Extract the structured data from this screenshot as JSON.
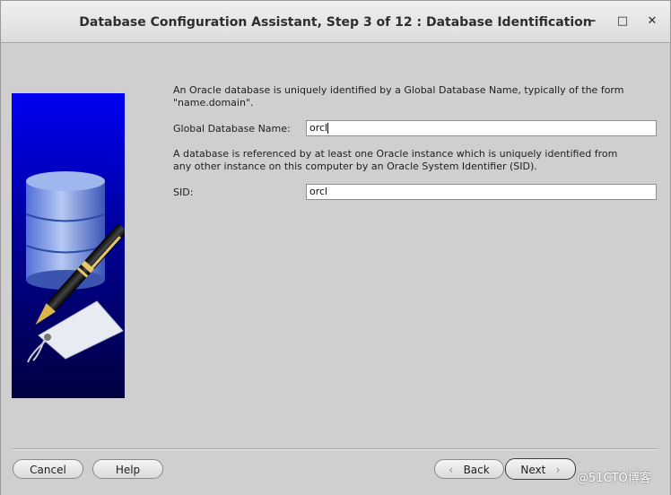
{
  "window": {
    "title": "Database Configuration Assistant, Step 3 of 12 : Database Identification",
    "minimize_glyph": "–",
    "maximize_glyph": "□",
    "close_glyph": "✕"
  },
  "main": {
    "intro_text_line1": "An Oracle database is uniquely identified by a Global Database Name, typically of the form",
    "intro_text_line2": "\"name.domain\".",
    "gdb_label": "Global Database Name:",
    "gdb_value": "orcl",
    "sid_text_line1": "A database is referenced by at least one Oracle instance which is uniquely identified from",
    "sid_text_line2": "any other instance on this computer by an Oracle System Identifier (SID).",
    "sid_label": "SID:",
    "sid_value": "orcl"
  },
  "buttons": {
    "cancel": "Cancel",
    "help": "Help",
    "back": "Back",
    "next": "Next",
    "back_icon": "‹",
    "next_icon": "›"
  },
  "watermark": "@51CTO博客",
  "colors": {
    "panel_blue_top": "#0000ff",
    "panel_blue_bottom": "#000050"
  }
}
